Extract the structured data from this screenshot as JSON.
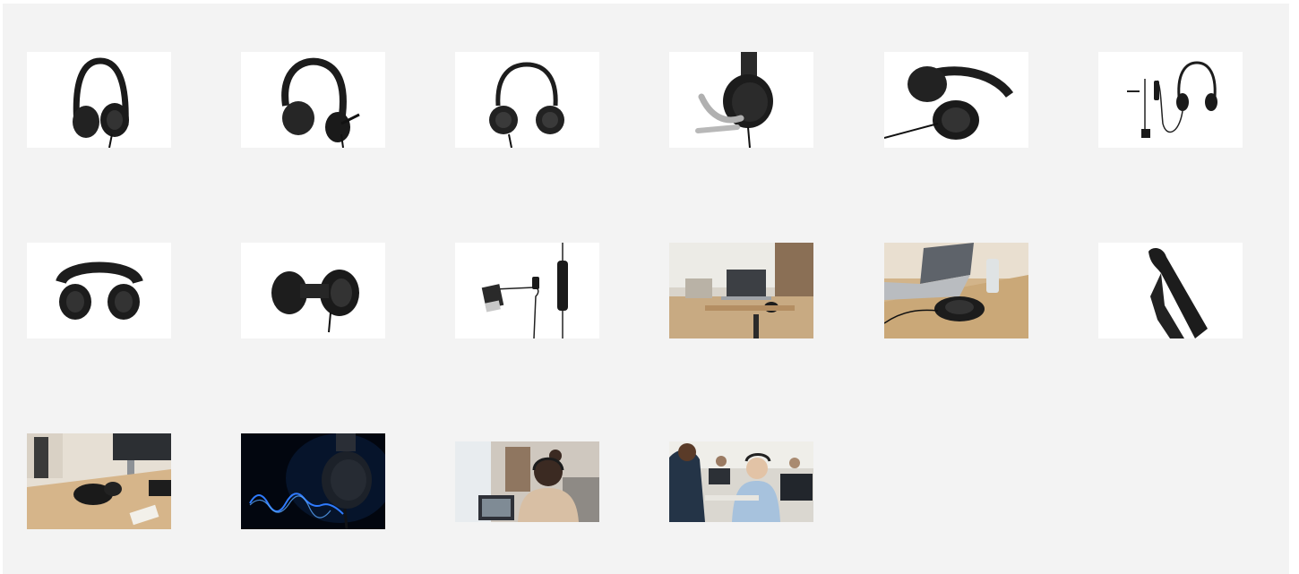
{
  "gallery": {
    "background": "#f3f3f3",
    "thumbnails": [
      {
        "id": "headset-front-angle",
        "kind": "product"
      },
      {
        "id": "headset-side-mic",
        "kind": "product"
      },
      {
        "id": "headset-front-flat",
        "kind": "product"
      },
      {
        "id": "headset-earcup-mic-closeup",
        "kind": "product"
      },
      {
        "id": "headset-lying-cable",
        "kind": "product"
      },
      {
        "id": "headset-full-cable-usb",
        "kind": "product"
      },
      {
        "id": "headset-top-view",
        "kind": "product"
      },
      {
        "id": "headset-folded",
        "kind": "product"
      },
      {
        "id": "usb-inline-control",
        "kind": "product"
      },
      {
        "id": "office-desk-laptop",
        "kind": "lifestyle"
      },
      {
        "id": "desk-laptop-headset-bottle",
        "kind": "lifestyle"
      },
      {
        "id": "headband-detail",
        "kind": "product"
      },
      {
        "id": "desk-monitor-headset",
        "kind": "lifestyle"
      },
      {
        "id": "headset-audio-wave",
        "kind": "lifestyle"
      },
      {
        "id": "woman-video-call",
        "kind": "lifestyle"
      },
      {
        "id": "call-center-team",
        "kind": "lifestyle"
      }
    ]
  }
}
